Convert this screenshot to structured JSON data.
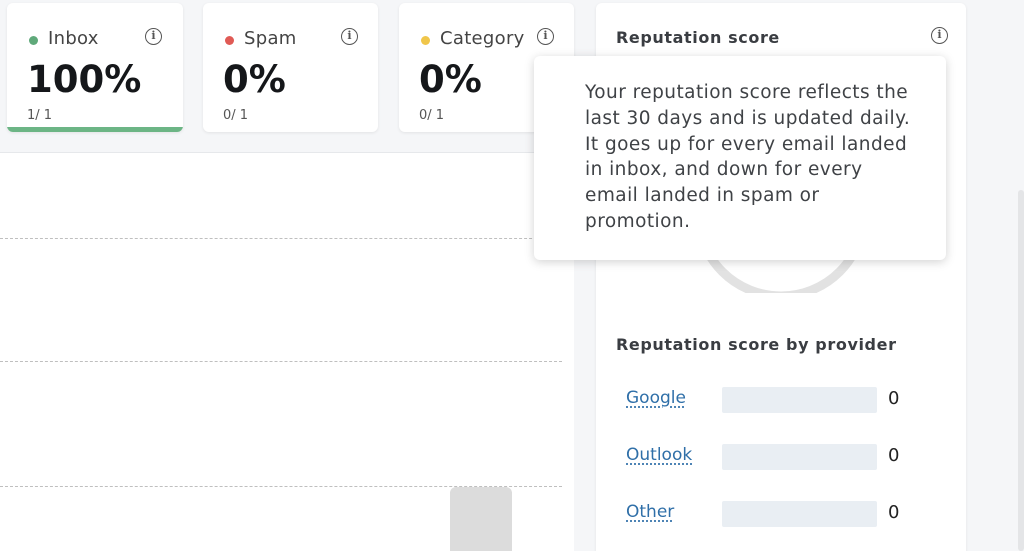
{
  "cards": [
    {
      "label": "Inbox",
      "percent": "100%",
      "ratio": "1/ 1",
      "dot_color": "#5fa97a",
      "bar_color": "#6cb585",
      "selected": true
    },
    {
      "label": "Spam",
      "percent": "0%",
      "ratio": "0/ 1",
      "dot_color": "#e05a55",
      "bar_color": null,
      "selected": false
    },
    {
      "label": "Category",
      "percent": "0%",
      "ratio": "0/ 1",
      "dot_color": "#f0c64a",
      "bar_color": null,
      "selected": false
    }
  ],
  "info_icon": "i",
  "reputation": {
    "title": "Reputation score",
    "tooltip": "Your reputation score reflects the last 30 days and is updated daily. It goes up for every email landed in inbox, and down for every email landed in spam or promotion.",
    "by_provider_title": "Reputation score by provider",
    "providers": [
      {
        "name": "Google",
        "value": "0"
      },
      {
        "name": "Outlook",
        "value": "0"
      },
      {
        "name": "Other",
        "value": "0"
      }
    ]
  }
}
